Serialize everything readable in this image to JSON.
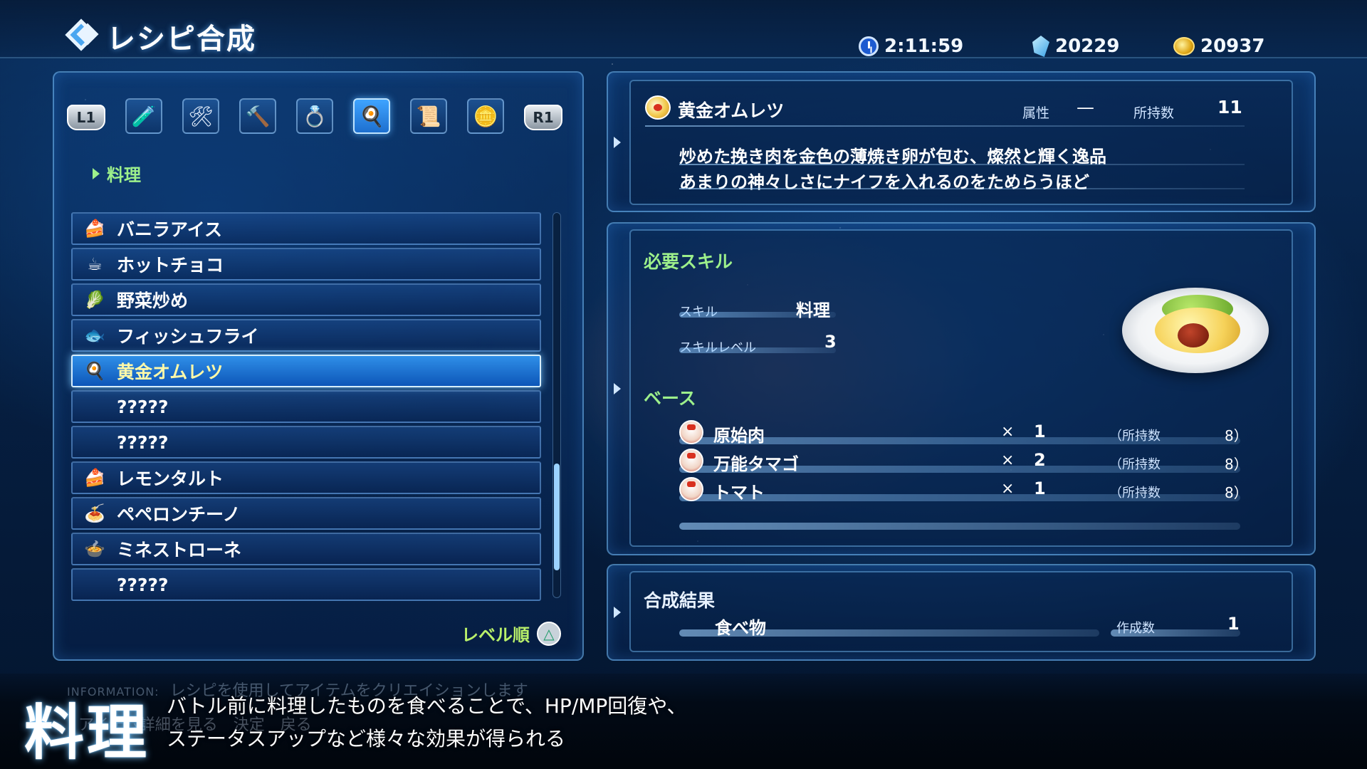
{
  "header": {
    "title": "レシピ合成",
    "time": "2:11:59",
    "crystals": "20229",
    "gold": "20937"
  },
  "tabs": {
    "left_shoulder": "L1",
    "right_shoulder": "R1",
    "items": [
      {
        "icon": "potion-icon",
        "glyph": "🧪"
      },
      {
        "icon": "tools-icon",
        "glyph": "🛠"
      },
      {
        "icon": "hammer-icon",
        "glyph": "🔨"
      },
      {
        "icon": "ring-icon",
        "glyph": "💍"
      },
      {
        "icon": "cooking-pot-icon",
        "glyph": "🍳",
        "active": true
      },
      {
        "icon": "writing-icon",
        "glyph": "📜"
      },
      {
        "icon": "ingot-icon",
        "glyph": "🪙"
      }
    ]
  },
  "category": "料理",
  "recipes": [
    {
      "label": "バニラアイス",
      "icon": "cake-icon",
      "glyph": "🍰"
    },
    {
      "label": "ホットチョコ",
      "icon": "cup-icon",
      "glyph": "☕"
    },
    {
      "label": "野菜炒め",
      "icon": "vegetable-icon",
      "glyph": "🥬"
    },
    {
      "label": "フィッシュフライ",
      "icon": "fish-icon",
      "glyph": "🐟"
    },
    {
      "label": "黄金オムレツ",
      "icon": "omelet-icon",
      "glyph": "🍳",
      "selected": true
    },
    {
      "label": "?????",
      "icon": "",
      "glyph": ""
    },
    {
      "label": "?????",
      "icon": "",
      "glyph": ""
    },
    {
      "label": "レモンタルト",
      "icon": "cake-icon",
      "glyph": "🍰"
    },
    {
      "label": "ペペロンチーノ",
      "icon": "dish-icon",
      "glyph": "🍝"
    },
    {
      "label": "ミネストローネ",
      "icon": "dish-icon",
      "glyph": "🍲"
    },
    {
      "label": "?????",
      "icon": "",
      "glyph": ""
    }
  ],
  "sort": {
    "label": "レベル順",
    "button_glyph": "△"
  },
  "selected_item": {
    "name": "黄金オムレツ",
    "attribute_label": "属性",
    "attribute_value": "—",
    "owned_label": "所持数",
    "owned_value": "11",
    "description_1": "炒めた挽き肉を金色の薄焼き卵が包む、燦然と輝く逸品",
    "description_2": "あまりの神々しさにナイフを入れるのをためらうほど"
  },
  "skill": {
    "section_title": "必要スキル",
    "skill_label": "スキル",
    "skill_value": "料理",
    "level_label": "スキルレベル",
    "level_value": "3"
  },
  "base": {
    "section_title": "ベース",
    "materials": [
      {
        "name": "原始肉",
        "x": "×",
        "qty": "1",
        "own_label": "（所持数",
        "own_value": "8）"
      },
      {
        "name": "万能タマゴ",
        "x": "×",
        "qty": "2",
        "own_label": "（所持数",
        "own_value": "8）"
      },
      {
        "name": "トマト",
        "x": "×",
        "qty": "1",
        "own_label": "（所持数",
        "own_value": "8）"
      }
    ]
  },
  "result": {
    "section_title": "合成結果",
    "type": "食べ物",
    "count_label": "作成数",
    "count_value": "1"
  },
  "info": {
    "tag": "INFORMATION:",
    "text": "レシピを使用してアイテムをクリエイションします",
    "controls": "アイテム詳細を見る　決定　戻る"
  },
  "caption": {
    "title": "料理",
    "line1": "バトル前に料理したものを食べることで、HP/MP回復や、",
    "line2": "ステータスアップなど様々な効果が得られる"
  }
}
